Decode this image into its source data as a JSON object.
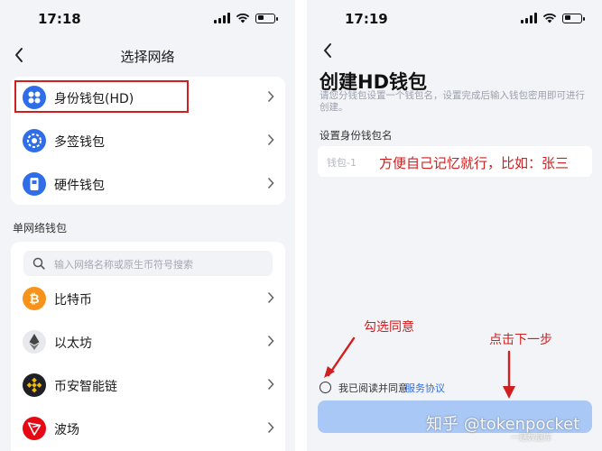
{
  "left_screen": {
    "status_time": "17:18",
    "nav_title": "选择网络",
    "wallet_types": [
      {
        "label": "身份钱包(HD)",
        "icon": "hd-wallet-icon"
      },
      {
        "label": "多签钱包",
        "icon": "multisig-wallet-icon"
      },
      {
        "label": "硬件钱包",
        "icon": "hardware-wallet-icon"
      }
    ],
    "section_label": "单网络钱包",
    "search_placeholder": "输入网络名称或原生币符号搜索",
    "networks": [
      {
        "label": "比特币",
        "icon": "bitcoin-icon"
      },
      {
        "label": "以太坊",
        "icon": "ethereum-icon"
      },
      {
        "label": "币安智能链",
        "icon": "bnb-chain-icon"
      },
      {
        "label": "波场",
        "icon": "tron-icon"
      }
    ]
  },
  "right_screen": {
    "status_time": "17:19",
    "title": "创建HD钱包",
    "description": "请您分钱包设置一个钱包名，设置完成后输入钱包密用即可进行创建。",
    "field_label": "设置身份钱包名",
    "field_placeholder": "钱包-1",
    "annotation_name": "方便自己记忆就行，比如：张三",
    "annotation_agree": "勾选同意",
    "annotation_next": "点击下一步",
    "agree_text": "我已阅读并同意",
    "agree_link": "服务协议"
  },
  "watermark": "知乎 @tokenpocket",
  "watermark_small": "一题数据库",
  "colors": {
    "accent": "#2f6ee8",
    "annotation": "#d11e1e",
    "button_disabled": "#a9c8f6"
  }
}
